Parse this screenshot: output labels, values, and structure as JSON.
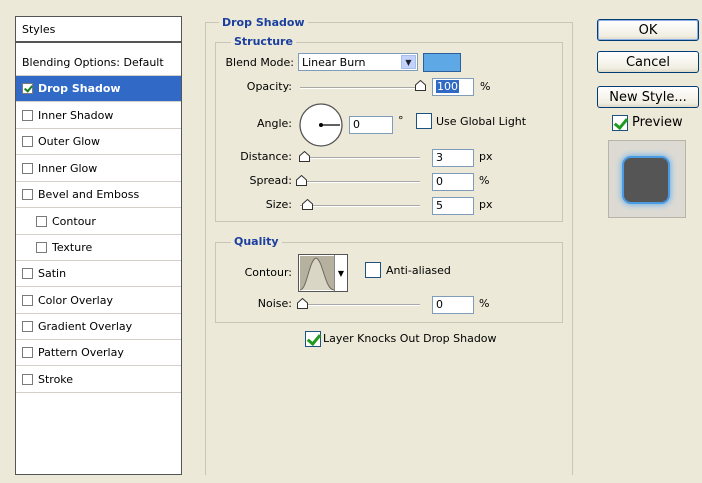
{
  "styles_list": {
    "header": "Styles",
    "blending_options": "Blending Options: Default",
    "items": [
      {
        "label": "Drop Shadow",
        "checked": true,
        "selected": true,
        "indent": false
      },
      {
        "label": "Inner Shadow",
        "checked": false,
        "selected": false,
        "indent": false
      },
      {
        "label": "Outer Glow",
        "checked": false,
        "selected": false,
        "indent": false
      },
      {
        "label": "Inner Glow",
        "checked": false,
        "selected": false,
        "indent": false
      },
      {
        "label": "Bevel and Emboss",
        "checked": false,
        "selected": false,
        "indent": false
      },
      {
        "label": "Contour",
        "checked": false,
        "selected": false,
        "indent": true
      },
      {
        "label": "Texture",
        "checked": false,
        "selected": false,
        "indent": true
      },
      {
        "label": "Satin",
        "checked": false,
        "selected": false,
        "indent": false
      },
      {
        "label": "Color Overlay",
        "checked": false,
        "selected": false,
        "indent": false
      },
      {
        "label": "Gradient Overlay",
        "checked": false,
        "selected": false,
        "indent": false
      },
      {
        "label": "Pattern Overlay",
        "checked": false,
        "selected": false,
        "indent": false
      },
      {
        "label": "Stroke",
        "checked": false,
        "selected": false,
        "indent": false
      }
    ]
  },
  "drop_shadow": {
    "title": "Drop Shadow",
    "structure": {
      "title": "Structure",
      "blend_mode_label": "Blend Mode:",
      "blend_mode_value": "Linear Burn",
      "shadow_color": "#5fa8e6",
      "opacity_label": "Opacity:",
      "opacity_value": "100",
      "opacity_unit": "%",
      "angle_label": "Angle:",
      "angle_value": "0",
      "angle_unit": "°",
      "use_global_light_label": "Use Global Light",
      "use_global_light_checked": false,
      "distance_label": "Distance:",
      "distance_value": "3",
      "distance_unit": "px",
      "spread_label": "Spread:",
      "spread_value": "0",
      "spread_unit": "%",
      "size_label": "Size:",
      "size_value": "5",
      "size_unit": "px"
    },
    "quality": {
      "title": "Quality",
      "contour_label": "Contour:",
      "anti_aliased_label": "Anti-aliased",
      "anti_aliased_checked": false,
      "noise_label": "Noise:",
      "noise_value": "0",
      "noise_unit": "%"
    },
    "layer_knocks_out_label": "Layer Knocks Out Drop Shadow",
    "layer_knocks_out_checked": true
  },
  "buttons": {
    "ok": "OK",
    "cancel": "Cancel",
    "new_style": "New Style...",
    "preview_label": "Preview",
    "preview_checked": true
  },
  "colors": {
    "selection": "#3169C6",
    "accent_title": "#1b3f9e",
    "dialog_bg": "#ECE9D8",
    "preview_swatch": "#555555",
    "preview_glow": "#4a9be0"
  }
}
